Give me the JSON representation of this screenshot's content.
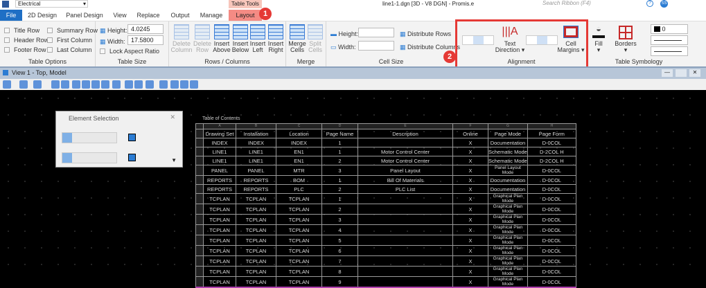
{
  "qat": {
    "workflow": "Electrical",
    "title": "line1-1.dgn [3D - V8 DGN] - Promis.e",
    "search_placeholder": "Search Ribbon (F4)",
    "user": "SS",
    "contextual": "Table Tools"
  },
  "tabs": [
    "File",
    "2D Design",
    "Panel Design",
    "View",
    "Replace",
    "Output",
    "Manage",
    "Layout"
  ],
  "ribbon": {
    "table_options": {
      "label": "Table Options",
      "items": [
        "Title Row",
        "Header Row",
        "Footer Row",
        "Summary Row",
        "First Column",
        "Last Column"
      ]
    },
    "table_size": {
      "label": "Table Size",
      "height_label": "Height:",
      "height": "4.0245",
      "width_label": "Width:",
      "width": "17.5800",
      "lock": "Lock Aspect Ratio"
    },
    "rows_columns": {
      "label": "Rows / Columns",
      "buttons": [
        [
          "Delete",
          "Column"
        ],
        [
          "Delete",
          "Row"
        ],
        [
          "Insert",
          "Above"
        ],
        [
          "Insert",
          "Below"
        ],
        [
          "Insert",
          "Left"
        ],
        [
          "Insert",
          "Right"
        ]
      ]
    },
    "merge": {
      "label": "Merge",
      "buttons": [
        [
          "Merge",
          "Cells"
        ],
        [
          "Split",
          "Cells"
        ]
      ]
    },
    "cell_size": {
      "label": "Cell Size",
      "height_label": "Height:",
      "width_label": "Width:",
      "distribute_rows": "Distribute Rows",
      "distribute_columns": "Distribute Columns"
    },
    "alignment": {
      "label": "Alignment",
      "text_direction": [
        "Text",
        "Direction ▾"
      ],
      "cell_margins": [
        "Cell",
        "Margins ▾"
      ]
    },
    "symbology": {
      "label": "Table Symbology",
      "fill": "Fill",
      "borders": "Borders",
      "color_value": "0"
    }
  },
  "badges": [
    "1",
    "2"
  ],
  "view": {
    "title": "View 1 - Top, Model"
  },
  "element_selection": {
    "title": "Element Selection"
  },
  "table": {
    "title": "Table of Contents",
    "letters": [
      "A",
      "B",
      "C",
      "D",
      "E",
      "F",
      "G",
      "H"
    ],
    "rows": [
      [
        "Drawing Set",
        "Installation",
        "Location",
        "Page Name",
        "Description",
        "Online",
        "Page Mode",
        "Page Form"
      ],
      [
        "INDEX",
        "INDEX",
        "INDEX",
        "1",
        "",
        "X",
        "Documentation",
        "D-0COL"
      ],
      [
        "LINE1",
        "LINE1",
        "EN1",
        "1",
        "Motor Control Center",
        "X",
        "Schematic Mode",
        "D-2COL H"
      ],
      [
        "LINE1",
        "LINE1",
        "EN1",
        "2",
        "Motor Control Center",
        "X",
        "Schematic Mode",
        "D-2COL H"
      ],
      [
        "PANEL",
        "PANEL",
        "MTR",
        "3",
        "Panel Layout",
        "X",
        "Panel Layout Mode",
        "D-0COL"
      ],
      [
        "REPORTS",
        "REPORTS",
        "BOM",
        "1",
        "Bill Of Materials",
        "X",
        "Documentation",
        "D-0COL"
      ],
      [
        "REPORTS",
        "REPORTS",
        "PLC",
        "2",
        "PLC List",
        "X",
        "Documentation",
        "D-0COL"
      ],
      [
        "TCPLAN",
        "TCPLAN",
        "TCPLAN",
        "1",
        "",
        "X",
        "Graphical Plan Mode",
        "D-0COL"
      ],
      [
        "TCPLAN",
        "TCPLAN",
        "TCPLAN",
        "2",
        "",
        "X",
        "Graphical Plan Mode",
        "D-0COL"
      ],
      [
        "TCPLAN",
        "TCPLAN",
        "TCPLAN",
        "3",
        "",
        "X",
        "Graphical Plan Mode",
        "D-0COL"
      ],
      [
        "TCPLAN",
        "TCPLAN",
        "TCPLAN",
        "4",
        "",
        "X",
        "Graphical Plan Mode",
        "D-0COL"
      ],
      [
        "TCPLAN",
        "TCPLAN",
        "TCPLAN",
        "5",
        "",
        "X",
        "Graphical Plan Mode",
        "D-0COL"
      ],
      [
        "TCPLAN",
        "TCPLAN",
        "TCPLAN",
        "6",
        "",
        "X",
        "Graphical Plan Mode",
        "D-0COL"
      ],
      [
        "TCPLAN",
        "TCPLAN",
        "TCPLAN",
        "7",
        "",
        "X",
        "Graphical Plan Mode",
        "D-0COL"
      ],
      [
        "TCPLAN",
        "TCPLAN",
        "TCPLAN",
        "8",
        "",
        "X",
        "Graphical Plan Mode",
        "D-0COL"
      ],
      [
        "TCPLAN",
        "TCPLAN",
        "TCPLAN",
        "9",
        "",
        "X",
        "Graphical Plan Mode",
        "D-0COL"
      ]
    ]
  }
}
